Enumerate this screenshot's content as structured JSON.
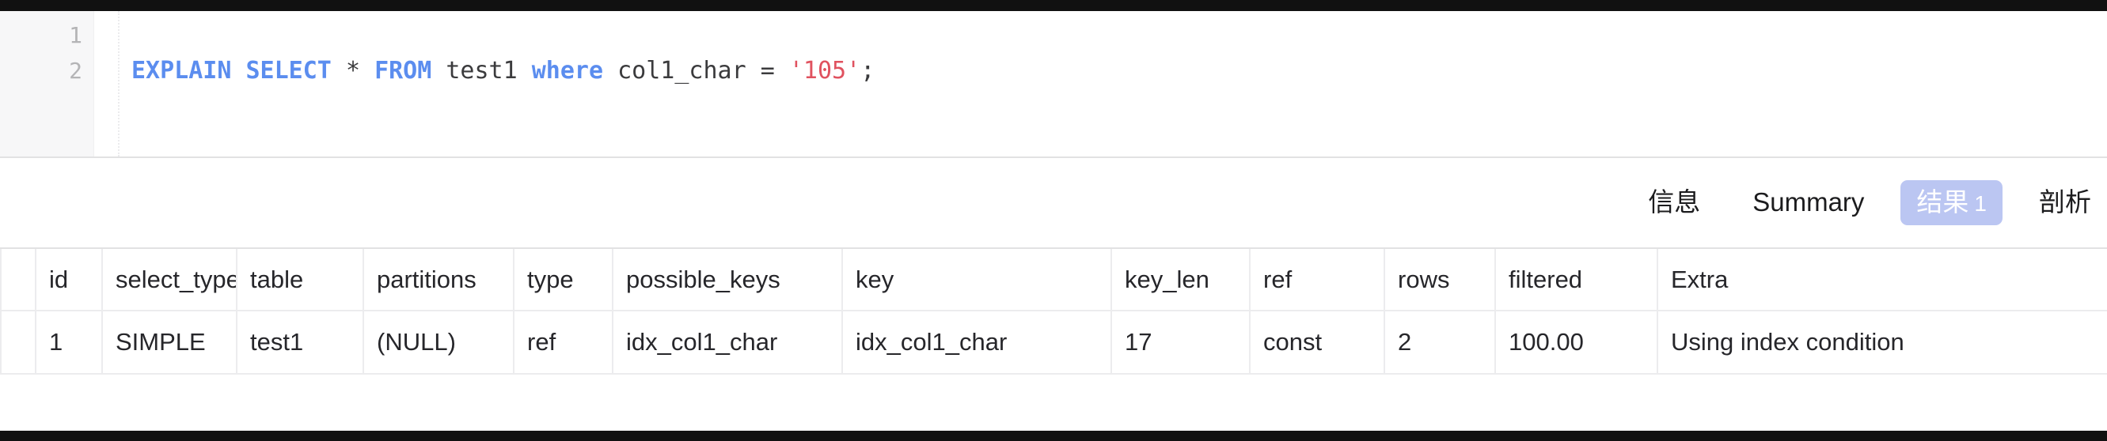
{
  "editor": {
    "line_numbers": [
      "1",
      "2"
    ],
    "lines": [
      {
        "tokens": []
      },
      {
        "tokens": [
          {
            "t": "EXPLAIN",
            "k": "kw"
          },
          {
            "t": " ",
            "k": "ws"
          },
          {
            "t": "SELECT",
            "k": "kw"
          },
          {
            "t": " ",
            "k": "ws"
          },
          {
            "t": "*",
            "k": "op"
          },
          {
            "t": " ",
            "k": "ws"
          },
          {
            "t": "FROM",
            "k": "kw"
          },
          {
            "t": " ",
            "k": "ws"
          },
          {
            "t": "test1",
            "k": "id"
          },
          {
            "t": " ",
            "k": "ws"
          },
          {
            "t": "where",
            "k": "kw"
          },
          {
            "t": " ",
            "k": "ws"
          },
          {
            "t": "col1_char",
            "k": "id"
          },
          {
            "t": " ",
            "k": "ws"
          },
          {
            "t": "=",
            "k": "op"
          },
          {
            "t": " ",
            "k": "ws"
          },
          {
            "t": "'105'",
            "k": "str"
          },
          {
            "t": ";",
            "k": "punc"
          }
        ]
      }
    ],
    "plain_text": "EXPLAIN SELECT * FROM test1 where col1_char = '105';"
  },
  "tabs": [
    {
      "label": "信息",
      "count": "",
      "active": false
    },
    {
      "label": "Summary",
      "count": "",
      "active": false
    },
    {
      "label": "结果",
      "count": "1",
      "active": true
    },
    {
      "label": "剖析",
      "count": "",
      "active": false
    }
  ],
  "result_grid": {
    "columns": [
      {
        "key": "id",
        "label": "id",
        "align": "right",
        "cls": "c-id"
      },
      {
        "key": "select_type",
        "label": "select_type",
        "align": "left",
        "cls": "c-select_type"
      },
      {
        "key": "table",
        "label": "table",
        "align": "left",
        "cls": "c-table"
      },
      {
        "key": "partitions",
        "label": "partitions",
        "align": "left",
        "cls": "c-partitions"
      },
      {
        "key": "type",
        "label": "type",
        "align": "left",
        "cls": "c-type"
      },
      {
        "key": "possible_keys",
        "label": "possible_keys",
        "align": "left",
        "cls": "c-possible"
      },
      {
        "key": "key",
        "label": "key",
        "align": "left",
        "cls": "c-key"
      },
      {
        "key": "key_len",
        "label": "key_len",
        "align": "left",
        "cls": "c-key_len"
      },
      {
        "key": "ref",
        "label": "ref",
        "align": "left",
        "cls": "c-ref"
      },
      {
        "key": "rows",
        "label": "rows",
        "align": "right",
        "cls": "c-rows"
      },
      {
        "key": "filtered",
        "label": "filtered",
        "align": "right",
        "cls": "c-filtered"
      },
      {
        "key": "Extra",
        "label": "Extra",
        "align": "left",
        "cls": "c-extra"
      }
    ],
    "rows": [
      {
        "cells": [
          {
            "v": "1",
            "align": "right",
            "cls": "c-id",
            "null": false
          },
          {
            "v": "SIMPLE",
            "align": "left",
            "cls": "c-select_type",
            "null": false
          },
          {
            "v": "test1",
            "align": "left",
            "cls": "c-table",
            "null": false
          },
          {
            "v": "(NULL)",
            "align": "left",
            "cls": "c-partitions",
            "null": true
          },
          {
            "v": "ref",
            "align": "left",
            "cls": "c-type",
            "null": false
          },
          {
            "v": "idx_col1_char",
            "align": "left",
            "cls": "c-possible",
            "null": false
          },
          {
            "v": "idx_col1_char",
            "align": "left",
            "cls": "c-key",
            "null": false
          },
          {
            "v": "17",
            "align": "left",
            "cls": "c-key_len",
            "null": false
          },
          {
            "v": "const",
            "align": "left",
            "cls": "c-ref",
            "null": false
          },
          {
            "v": "2",
            "align": "right",
            "cls": "c-rows",
            "null": false
          },
          {
            "v": "100.00",
            "align": "right",
            "cls": "c-filtered",
            "null": false
          },
          {
            "v": "Using index condition",
            "align": "left",
            "cls": "c-extra",
            "null": false
          }
        ]
      }
    ]
  },
  "colors": {
    "keyword": "#5b8def",
    "string": "#e0525f",
    "active_tab_bg": "#bbc6f2",
    "active_tab_fg": "#ffffff",
    "grid_border": "#ececee",
    "null_text": "#b9b9bd",
    "gutter_bg": "#f7f7f8",
    "chrome_bar": "#111111"
  }
}
